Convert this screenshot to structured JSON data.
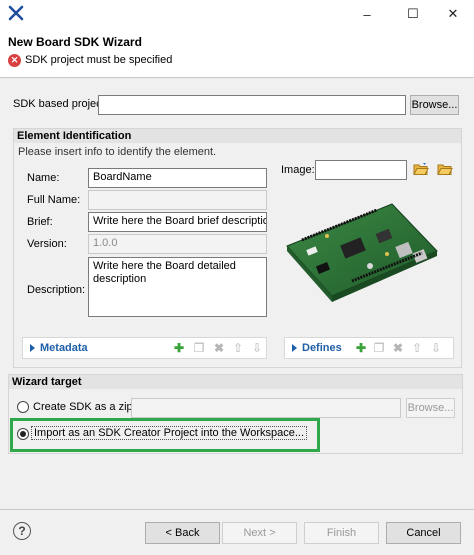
{
  "titlebar": {
    "app_icon": "eclipse-x-icon",
    "minimize": "–",
    "maximize": "☐",
    "close": "✕"
  },
  "header": {
    "title": "New Board SDK Wizard",
    "error": "SDK project must be specified"
  },
  "sdk": {
    "label": "SDK based project",
    "value": "",
    "browse": "Browse..."
  },
  "element": {
    "title": "Element Identification",
    "hint": "Please insert info to identify the element.",
    "name_label": "Name:",
    "name_value": "BoardName",
    "fullname_label": "Full Name:",
    "fullname_value": "",
    "brief_label": "Brief:",
    "brief_value": "Write here the Board brief description",
    "version_label": "Version:",
    "version_value": "1.0.0",
    "description_label": "Description:",
    "description_value": "Write here the Board detailed description",
    "image_label": "Image:",
    "image_value": ""
  },
  "metadata": {
    "label": "Metadata"
  },
  "defines": {
    "label": "Defines"
  },
  "wizard_target": {
    "title": "Wizard target",
    "option_zip": "Create SDK as a zip...",
    "option_zip_value": "",
    "browse": "Browse...",
    "option_import": "Import as an SDK Creator Project into the Workspace..."
  },
  "footer": {
    "help": "?",
    "back": "< Back",
    "next": "Next >",
    "finish": "Finish",
    "cancel": "Cancel"
  },
  "colors": {
    "accent_blue": "#1f5fa8",
    "error_red": "#d94141",
    "highlight_green": "#2ea84a"
  }
}
